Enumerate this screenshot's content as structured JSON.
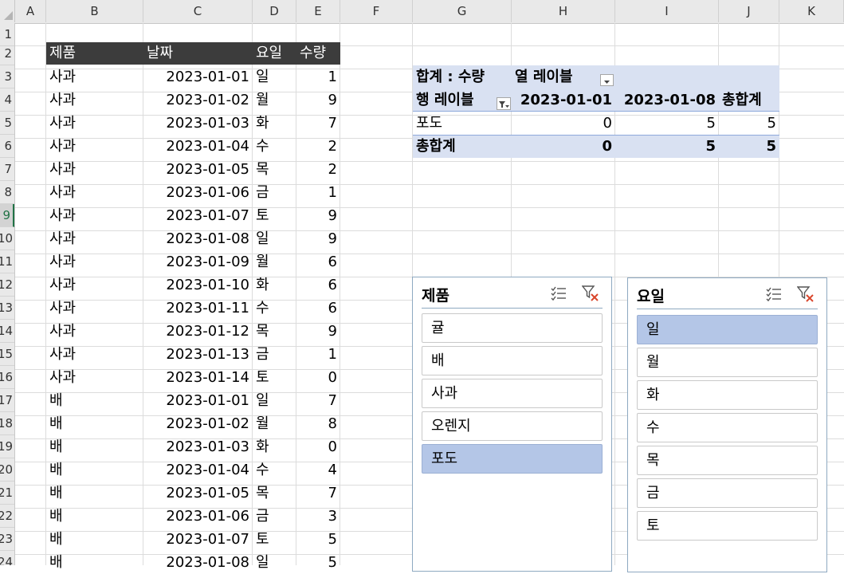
{
  "columns": [
    "A",
    "B",
    "C",
    "D",
    "E",
    "F",
    "G",
    "H",
    "I",
    "J",
    "K"
  ],
  "row_numbers": [
    "1",
    "2",
    "3",
    "4",
    "5",
    "6",
    "7",
    "8",
    "9",
    "10",
    "11",
    "12",
    "13",
    "14",
    "15",
    "16",
    "17",
    "18",
    "19",
    "20",
    "21",
    "22",
    "23",
    "24"
  ],
  "table": {
    "headers": [
      "제품",
      "날짜",
      "요일",
      "수량"
    ],
    "rows": [
      [
        "사과",
        "2023-01-01",
        "일",
        "1"
      ],
      [
        "사과",
        "2023-01-02",
        "월",
        "9"
      ],
      [
        "사과",
        "2023-01-03",
        "화",
        "7"
      ],
      [
        "사과",
        "2023-01-04",
        "수",
        "2"
      ],
      [
        "사과",
        "2023-01-05",
        "목",
        "2"
      ],
      [
        "사과",
        "2023-01-06",
        "금",
        "1"
      ],
      [
        "사과",
        "2023-01-07",
        "토",
        "9"
      ],
      [
        "사과",
        "2023-01-08",
        "일",
        "9"
      ],
      [
        "사과",
        "2023-01-09",
        "월",
        "6"
      ],
      [
        "사과",
        "2023-01-10",
        "화",
        "6"
      ],
      [
        "사과",
        "2023-01-11",
        "수",
        "6"
      ],
      [
        "사과",
        "2023-01-12",
        "목",
        "9"
      ],
      [
        "사과",
        "2023-01-13",
        "금",
        "1"
      ],
      [
        "사과",
        "2023-01-14",
        "토",
        "0"
      ],
      [
        "배",
        "2023-01-01",
        "일",
        "7"
      ],
      [
        "배",
        "2023-01-02",
        "월",
        "8"
      ],
      [
        "배",
        "2023-01-03",
        "화",
        "0"
      ],
      [
        "배",
        "2023-01-04",
        "수",
        "4"
      ],
      [
        "배",
        "2023-01-05",
        "목",
        "7"
      ],
      [
        "배",
        "2023-01-06",
        "금",
        "3"
      ],
      [
        "배",
        "2023-01-07",
        "토",
        "5"
      ],
      [
        "배",
        "2023-01-08",
        "일",
        "5"
      ]
    ]
  },
  "pivot": {
    "sum_label": "합계 : 수량",
    "col_labels": "열 레이블",
    "row_labels": "행 레이블",
    "col1": "2023-01-01",
    "col2": "2023-01-08",
    "grand_total_col": "총합계",
    "data_row": {
      "label": "포도",
      "v1": "0",
      "v2": "5",
      "total": "5"
    },
    "total_row": {
      "label": "총합계",
      "v1": "0",
      "v2": "5",
      "total": "5"
    }
  },
  "slicer_product": {
    "title": "제품",
    "items": [
      "귤",
      "배",
      "사과",
      "오렌지",
      "포도"
    ],
    "selected": "포도"
  },
  "slicer_day": {
    "title": "요일",
    "items": [
      "일",
      "월",
      "화",
      "수",
      "목",
      "금",
      "토"
    ],
    "selected": "일"
  },
  "colors": {
    "header_bg": "#3c3c3c",
    "pivot_band": "#d9e1f2",
    "slicer_selected": "#b4c6e7",
    "excel_green": "#217346"
  },
  "icons": {
    "multi_select": "multi-select-icon",
    "clear_filter": "clear-filter-icon",
    "filter_dropdown": "filter-dropdown-icon"
  }
}
